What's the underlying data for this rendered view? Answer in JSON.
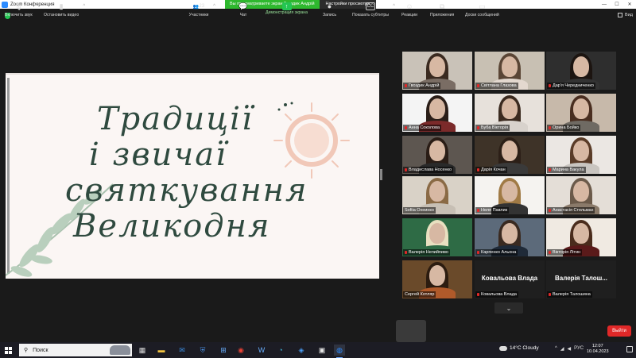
{
  "window": {
    "title": "Zoom Конференция",
    "viewing_banner": "Вы просматриваете экран Гвоздик Андрій",
    "view_settings": "Настройки просмотра",
    "view_button": "Вид"
  },
  "slide": {
    "lines": [
      "Традиції",
      "і звичаї",
      "святкування",
      "Великодня"
    ]
  },
  "participants": [
    {
      "name": "Гвоздик Андрій",
      "muted": true
    },
    {
      "name": "Світлана Глазова",
      "muted": true
    },
    {
      "name": "Дар'я Чередниченко",
      "muted": true
    },
    {
      "name": "Анна Соколова",
      "muted": true
    },
    {
      "name": "Буба Вікторія",
      "muted": true
    },
    {
      "name": "Орина Бойко",
      "muted": true
    },
    {
      "name": "Владислава Носенко",
      "muted": true
    },
    {
      "name": "Дарія Кочан",
      "muted": true
    },
    {
      "name": "Марина Вакула",
      "muted": true
    },
    {
      "name": "Sofiia Охеинко",
      "muted": false,
      "active": true
    },
    {
      "name": "Неля Павлик",
      "muted": true
    },
    {
      "name": "Анастасія Стельмах",
      "muted": true
    },
    {
      "name": "Валерія Непийпиво",
      "muted": true
    },
    {
      "name": "Карпенко Альона",
      "muted": true
    },
    {
      "name": "Вікторія Літин",
      "muted": true
    },
    {
      "name": "Сергей Котляр",
      "muted": false
    },
    {
      "name": "Ковальова Влада",
      "muted": true,
      "big_name": "Ковальова Влада"
    },
    {
      "name": "Валерія Талошина",
      "muted": true,
      "big_name": "Валерія Талош..."
    }
  ],
  "toolbar": {
    "unmute": "Включить звук",
    "stop_video": "Остановить видео",
    "participants": "Участники",
    "participants_count": "23",
    "chat": "Чат",
    "share_screen": "Демонстрация экрана",
    "record": "Запись",
    "captions": "Показать субтитры",
    "reactions": "Реакции",
    "apps": "Приложения",
    "whiteboards": "Доски сообщений",
    "leave": "Выйти"
  },
  "taskbar": {
    "search_placeholder": "Поиск",
    "weather": "14°C Cloudy",
    "lang": "РУС",
    "time": "12:07",
    "date": "10.04.2023"
  },
  "colors": {
    "accent_green": "#23c552",
    "leave_red": "#e02828",
    "active_speaker": "#b6d43a",
    "slide_ink": "#2f4a3f"
  }
}
